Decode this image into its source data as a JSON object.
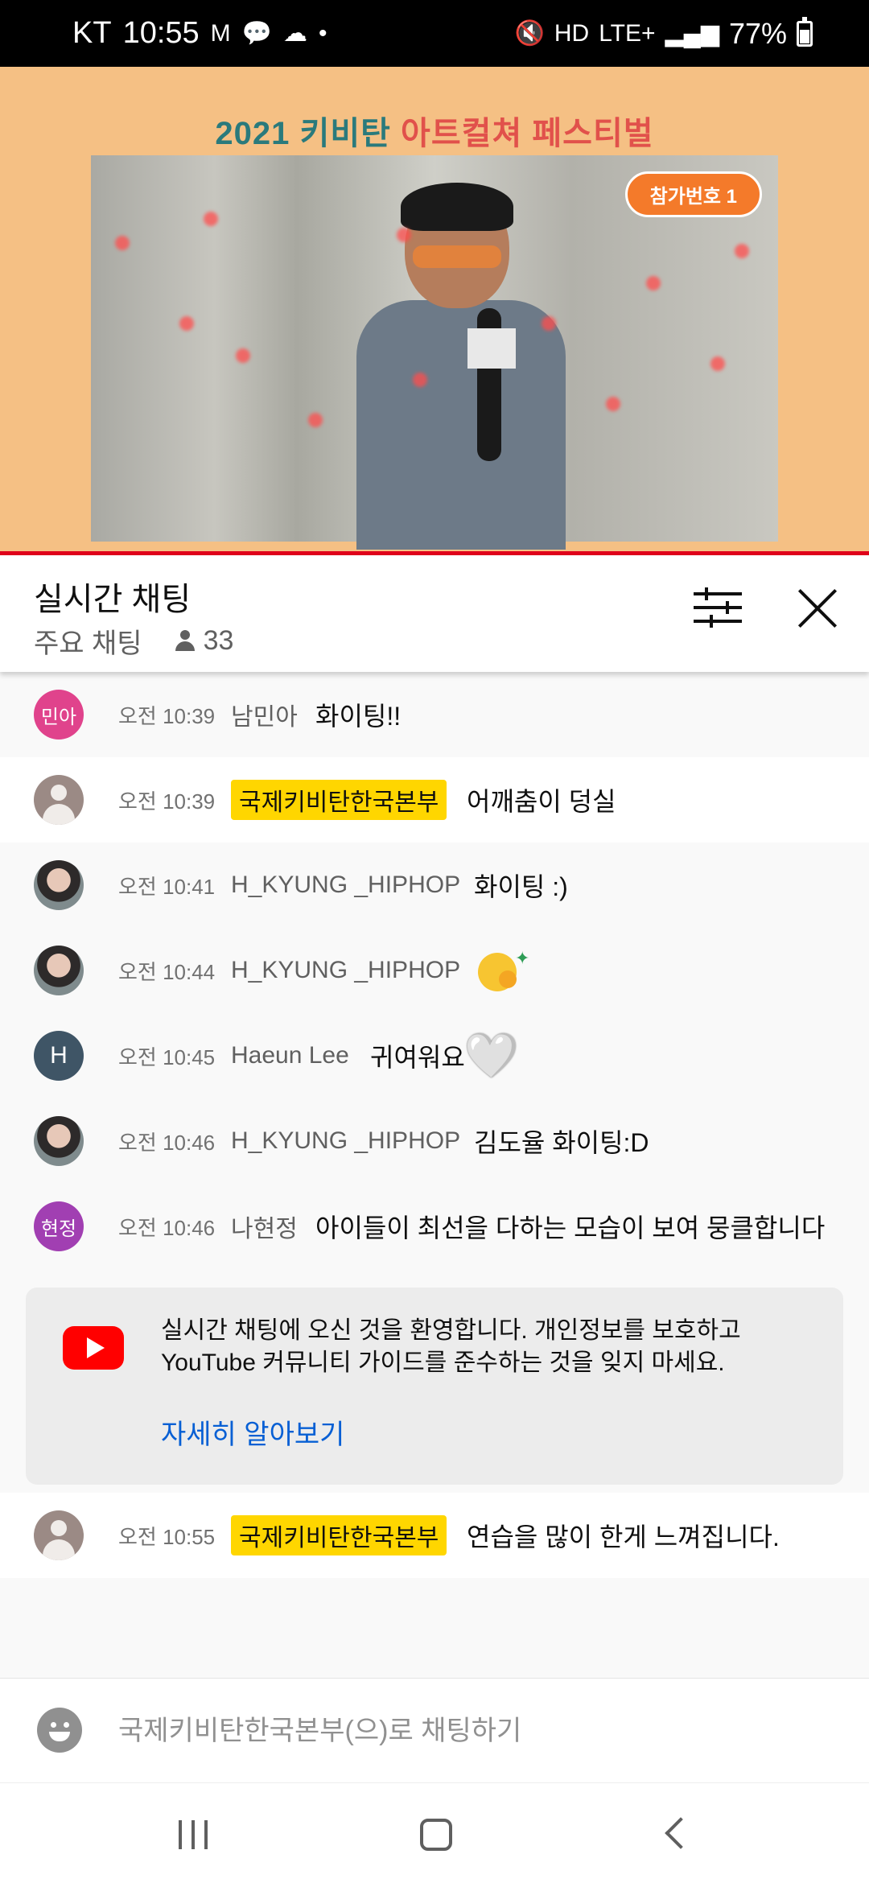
{
  "status_bar": {
    "carrier": "KT",
    "time": "10:55",
    "right_icons": "mute-icon hd-icon lte-icon signal-icon",
    "network": "LTE+",
    "battery": "77%"
  },
  "video": {
    "title_prefix": "2021 키비탄 ",
    "title_accent": "아트컬쳐 페스티벌",
    "badge": "참가번호 1",
    "accent_color": "#e0001b"
  },
  "chat_header": {
    "title": "실시간 채팅",
    "mode": "주요 채팅",
    "viewer_count": "33"
  },
  "messages": [
    {
      "avatar": "민아",
      "time": "오전 10:39",
      "author": "남민아",
      "text": "화이팅!!"
    },
    {
      "avatar": "",
      "time": "오전 10:39",
      "author": "국제키비탄한국본부",
      "text": "어깨춤이 덩실"
    },
    {
      "avatar": "",
      "time": "오전 10:41",
      "author": "H_KYUNG _HIPHOP",
      "text": "화이팅 :)"
    },
    {
      "avatar": "",
      "time": "오전 10:44",
      "author": "H_KYUNG _HIPHOP",
      "text": "hugging-face-emoji"
    },
    {
      "avatar": "H",
      "time": "오전 10:45",
      "author": "Haeun Lee",
      "text": "귀여워요",
      "emoji": "🤍"
    },
    {
      "avatar": "",
      "time": "오전 10:46",
      "author": "H_KYUNG _HIPHOP",
      "text": "김도율 화이팅:D"
    },
    {
      "avatar": "현정",
      "time": "오전 10:46",
      "author": "나현정",
      "text": "아이들이 최선을 다하는 모습이 보여 뭉클합니다"
    },
    {
      "avatar": "",
      "time": "오전 10:55",
      "author": "국제키비탄한국본부",
      "text": "연습을 많이 한게 느껴집니다."
    }
  ],
  "welcome": {
    "text": "실시간 채팅에 오신 것을 환영합니다. 개인정보를 보호하고 YouTube 커뮤니티 가이드를 준수하는 것을 잊지 마세요.",
    "link": "자세히 알아보기",
    "link_color": "#065fd4"
  },
  "input": {
    "placeholder": "국제키비탄한국본부(으)로 채팅하기"
  },
  "colors": {
    "owner_badge": "#ffd600",
    "youtube_red": "#ff0000"
  }
}
